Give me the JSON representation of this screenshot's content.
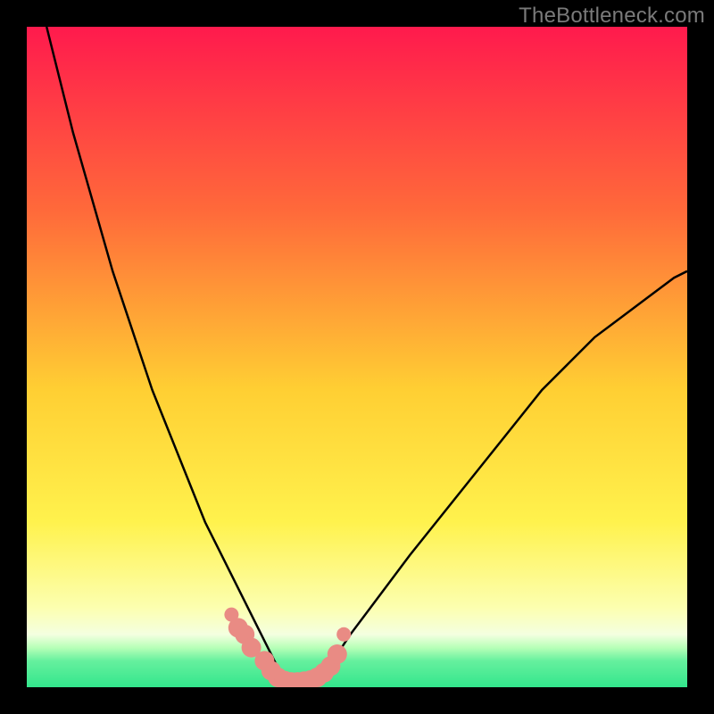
{
  "watermark": "TheBottleneck.com",
  "colors": {
    "frame": "#000000",
    "gradient_top": "#ff1a4d",
    "gradient_mid1": "#ff7a33",
    "gradient_mid2": "#ffd633",
    "gradient_mid3": "#ffff66",
    "gradient_bottom_hi": "#f6ffcc",
    "gradient_green": "#33e68c",
    "curve": "#000000",
    "marker": "#e98b84"
  },
  "chart_data": {
    "type": "line",
    "title": "",
    "xlabel": "",
    "ylabel": "",
    "xlim": [
      0,
      100
    ],
    "ylim": [
      0,
      100
    ],
    "x": [
      3,
      5,
      7,
      9,
      11,
      13,
      15,
      17,
      19,
      21,
      23,
      25,
      27,
      29,
      31,
      33,
      35,
      37,
      38,
      39,
      40,
      41,
      43,
      45,
      47,
      49,
      52,
      55,
      58,
      62,
      66,
      70,
      74,
      78,
      82,
      86,
      90,
      94,
      98,
      100
    ],
    "values": [
      100,
      92,
      84,
      77,
      70,
      63,
      57,
      51,
      45,
      40,
      35,
      30,
      25,
      21,
      17,
      13,
      9,
      5,
      3,
      1.5,
      0.8,
      0.8,
      1.5,
      3,
      5,
      8,
      12,
      16,
      20,
      25,
      30,
      35,
      40,
      45,
      49,
      53,
      56,
      59,
      62,
      63
    ],
    "markers": {
      "x": [
        31,
        32,
        33,
        34,
        36,
        37,
        38,
        39,
        40,
        41,
        42,
        43,
        44,
        45,
        46,
        47,
        48
      ],
      "y": [
        11,
        9,
        8,
        6,
        4,
        2.5,
        1.5,
        1,
        0.8,
        0.8,
        0.9,
        1.1,
        1.5,
        2.2,
        3.2,
        5,
        8
      ]
    }
  }
}
